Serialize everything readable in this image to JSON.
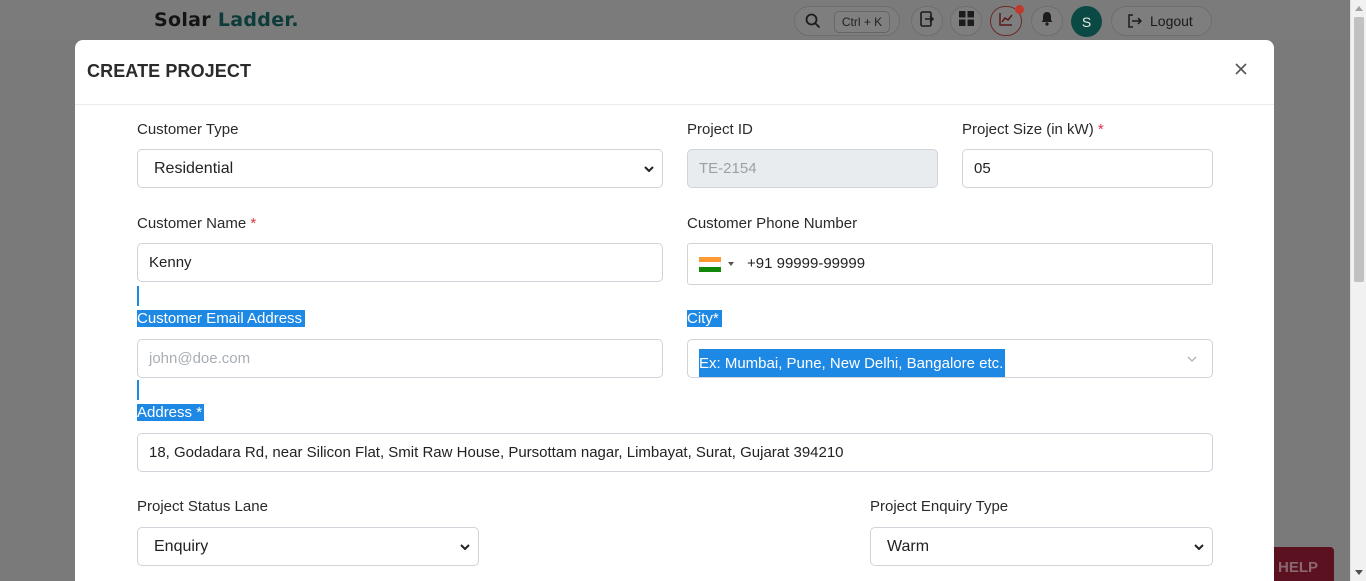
{
  "app": {
    "logo_part1": "Solar",
    "logo_part2": "Ladder.",
    "search_shortcut": "Ctrl + K",
    "avatar_initial": "S",
    "logout_label": "Logout",
    "help_label": "HELP"
  },
  "modal": {
    "title": "CREATE PROJECT",
    "close_icon": "close-icon"
  },
  "form": {
    "customer_type": {
      "label": "Customer Type",
      "value": "Residential"
    },
    "project_id": {
      "label": "Project ID",
      "value": "TE-2154"
    },
    "project_size": {
      "label": "Project Size (in kW)",
      "required_mark": "*",
      "value": "05"
    },
    "customer_name": {
      "label": "Customer Name",
      "required_mark": "*",
      "value": "Kenny"
    },
    "customer_phone": {
      "label": "Customer Phone Number",
      "value": "+91 99999-99999",
      "country_flag": "india-flag-icon"
    },
    "customer_email": {
      "label": "Customer Email Address",
      "placeholder": "john@doe.com"
    },
    "city": {
      "label": "City*",
      "placeholder": "Ex: Mumbai, Pune, New Delhi, Bangalore etc."
    },
    "address": {
      "label": "Address *",
      "value": "18, Godadara Rd, near Silicon Flat, Smit Raw House, Pursottam nagar, Limbayat, Surat, Gujarat 394210"
    },
    "project_status_lane": {
      "label": "Project Status Lane",
      "value": "Enquiry"
    },
    "project_enquiry_type": {
      "label": "Project Enquiry Type",
      "value": "Warm"
    }
  },
  "colors": {
    "highlight": "#1e88e5",
    "required": "#dc3545",
    "overlay": "#7a7a7a"
  }
}
